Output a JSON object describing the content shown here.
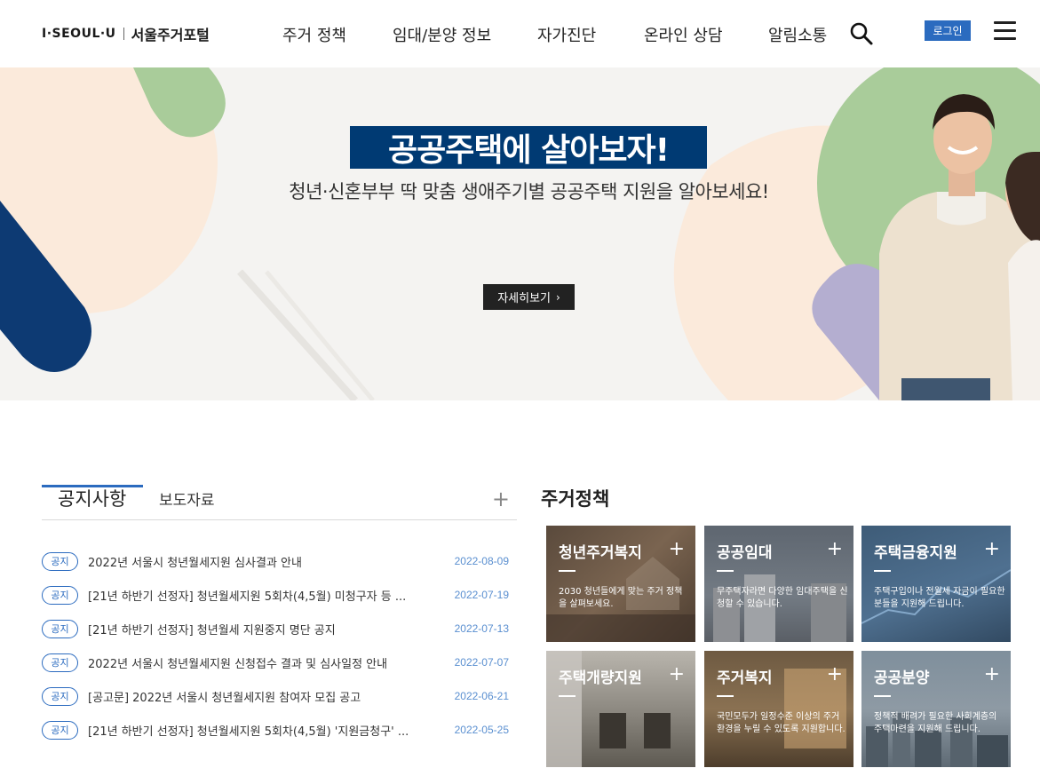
{
  "header": {
    "logo_brand": "I·SEOUL·U",
    "logo_site": "서울주거포털",
    "nav": [
      "주거 정책",
      "임대/분양 정보",
      "자가진단",
      "온라인 상담",
      "알림소통"
    ],
    "login_label": "로그인"
  },
  "hero": {
    "title": "공공주택에 살아보자!",
    "subtitle": "청년·신혼부부 딱 맞춤 생애주기별 공공주택 지원을 알아보세요!",
    "button_label": "자세히보기"
  },
  "notice": {
    "tab_active": "공지사항",
    "tab_second": "보도자료",
    "more": "+",
    "items": [
      {
        "badge": "공지",
        "title": "2022년 서울시 청년월세지원 심사결과 안내",
        "date": "2022-08-09"
      },
      {
        "badge": "공지",
        "title": "[21년 하반기 선정자] 청년월세지원 5회차(4,5월) 미청구자 등 ...",
        "date": "2022-07-19"
      },
      {
        "badge": "공지",
        "title": "[21년 하반기 선정자] 청년월세 지원중지 명단 공지",
        "date": "2022-07-13"
      },
      {
        "badge": "공지",
        "title": "2022년 서울시 청년월세지원 신청접수 결과 및 심사일정 안내",
        "date": "2022-07-07"
      },
      {
        "badge": "공지",
        "title": "[공고문] 2022년 서울시 청년월세지원 참여자 모집 공고",
        "date": "2022-06-21"
      },
      {
        "badge": "공지",
        "title": "[21년 하반기 선정자] 청년월세지원 5회차(4,5월) '지원금청구' ...",
        "date": "2022-05-25"
      }
    ]
  },
  "policy": {
    "title": "주거정책",
    "cards": [
      {
        "name": "청년주거복지",
        "desc": "2030 청년들에게 맞는 주거 정책을 살펴보세요."
      },
      {
        "name": "공공임대",
        "desc": "무주택자라면 다양한 임대주택을 신청할 수 있습니다."
      },
      {
        "name": "주택금융지원",
        "desc": "주택구입이나 전월세 자금이 필요한 분들을 지원해 드립니다."
      },
      {
        "name": "주택개량지원",
        "desc": ""
      },
      {
        "name": "주거복지",
        "desc": "국민모두가 일정수준 이상의 주거 환경을 누릴 수 있도록 지원합니다."
      },
      {
        "name": "공공분양",
        "desc": "정책적 배려가 필요한 사회계층의 주택마련을 지원해 드립니다."
      }
    ]
  },
  "colors": {
    "brand_navy": "#003a73",
    "accent_blue": "#2b6bbf",
    "green": "#a9cc9a",
    "peach": "#fbeadb",
    "lavender": "#b4aed0"
  },
  "icons": [
    "search-icon",
    "menu-icon",
    "chevron-right-icon",
    "plus-icon"
  ]
}
